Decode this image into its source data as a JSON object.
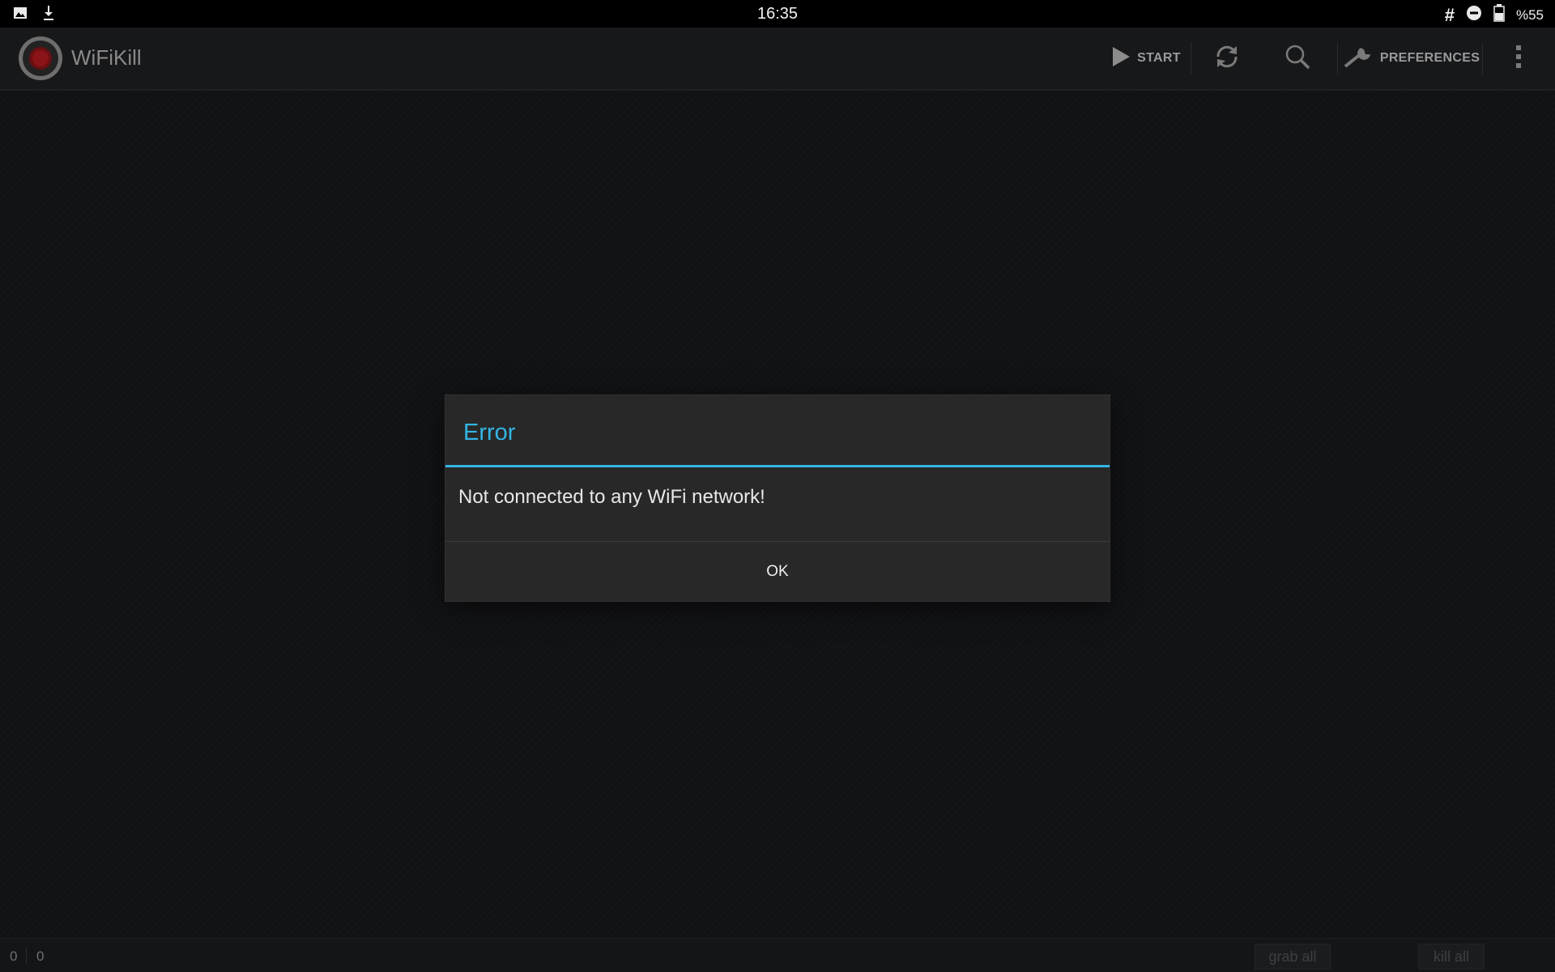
{
  "status_bar": {
    "time": "16:35",
    "battery": "%55",
    "left_icons": [
      "gallery-notification-icon",
      "download-notification-icon"
    ],
    "right_icons": [
      "hash-icon",
      "do-not-disturb-icon",
      "battery-icon"
    ]
  },
  "action_bar": {
    "app_title": "WiFiKill",
    "start_label": "START",
    "preferences_label": "PREFERENCES"
  },
  "dialog": {
    "title": "Error",
    "message": "Not connected to any WiFi network!",
    "ok_label": "OK"
  },
  "bottom_bar": {
    "count_left": "0",
    "count_right": "0",
    "grab_all_label": "grab all",
    "kill_all_label": "kill all"
  },
  "colors": {
    "accent": "#33b5e5",
    "background": "#111214",
    "dialog_background": "#282828"
  }
}
